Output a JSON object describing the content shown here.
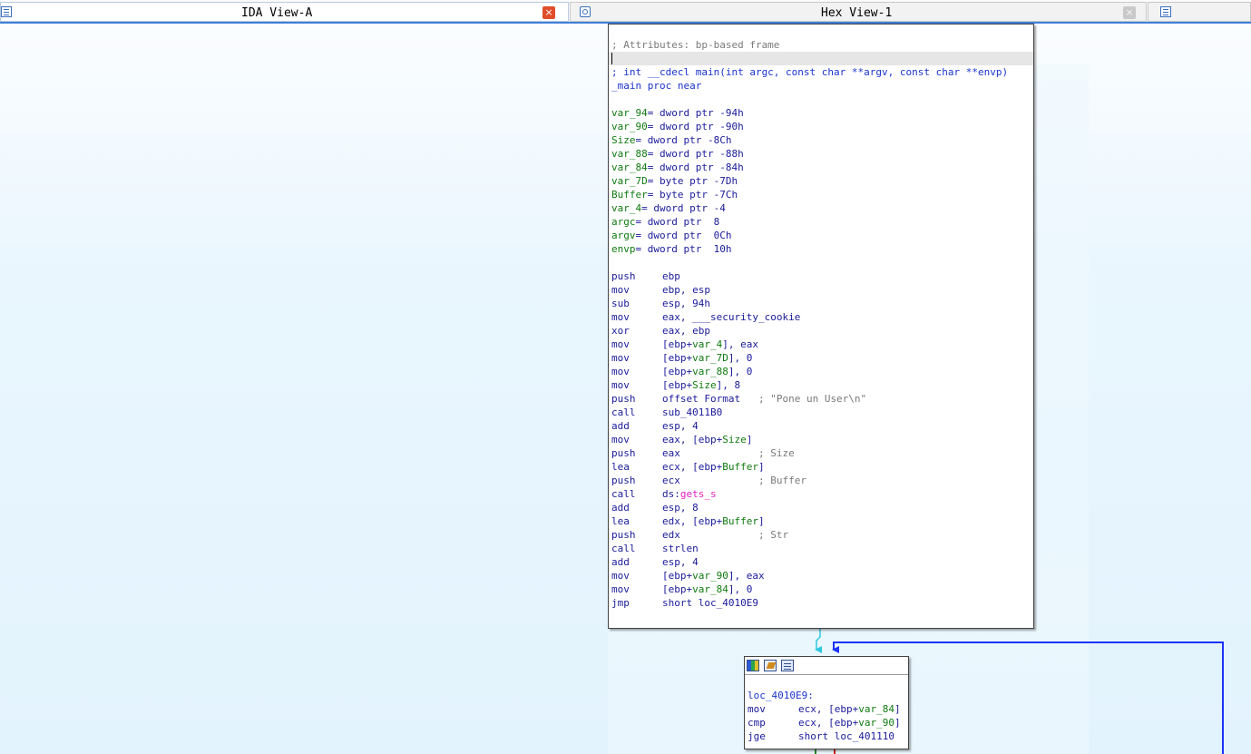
{
  "tabs": [
    {
      "title": "IDA View-A",
      "icon": "listing-icon",
      "close": "×"
    },
    {
      "title": "Hex View-1",
      "icon": "hex-view-icon",
      "close": "×"
    },
    {
      "icon": "structures-icon"
    }
  ],
  "colors": {
    "accent": "#3f7fd9",
    "close_active": "#e04e2c",
    "edge_blue": "#1a33ff",
    "edge_cyan": "#2ec8e0",
    "comment": "#7a7a7a",
    "mnemonic": "#1a1a9a",
    "var_name": "#0f7a0f",
    "import": "#e020c0"
  },
  "node_main": {
    "attr": "; Attributes: bp-based frame",
    "sig": "; int __cdecl main(int argc, const char **argv, const char **envp)",
    "proc": "_main proc near",
    "locals": [
      {
        "name": "var_94",
        "rest": "= dword ptr -94h"
      },
      {
        "name": "var_90",
        "rest": "= dword ptr -90h"
      },
      {
        "name": "Size",
        "rest": "= dword ptr -8Ch"
      },
      {
        "name": "var_88",
        "rest": "= dword ptr -88h"
      },
      {
        "name": "var_84",
        "rest": "= dword ptr -84h"
      },
      {
        "name": "var_7D",
        "rest": "= byte ptr -7Dh"
      },
      {
        "name": "Buffer",
        "rest": "= byte ptr -7Ch"
      },
      {
        "name": "var_4",
        "rest": "= dword ptr -4"
      },
      {
        "name": "argc",
        "rest": "= dword ptr  8"
      },
      {
        "name": "argv",
        "rest": "= dword ptr  0Ch"
      },
      {
        "name": "envp",
        "rest": "= dword ptr  10h"
      }
    ],
    "code": [
      {
        "m": "push",
        "a": "ebp",
        "c": ""
      },
      {
        "m": "mov",
        "a": "ebp, esp",
        "c": ""
      },
      {
        "m": "sub",
        "a": "esp, 94h",
        "c": ""
      },
      {
        "m": "mov",
        "a": "eax, ___security_cookie",
        "c": ""
      },
      {
        "m": "xor",
        "a": "eax, ebp",
        "c": ""
      },
      {
        "m": "mov",
        "a": "[ebp+var_4], eax",
        "c": ""
      },
      {
        "m": "mov",
        "a": "[ebp+var_7D], 0",
        "c": ""
      },
      {
        "m": "mov",
        "a": "[ebp+var_88], 0",
        "c": ""
      },
      {
        "m": "mov",
        "a": "[ebp+Size], 8",
        "c": ""
      },
      {
        "m": "push",
        "a": "offset Format   ",
        "c": "; \"Pone un User\\n\""
      },
      {
        "m": "call",
        "a": "sub_4011B0",
        "c": ""
      },
      {
        "m": "add",
        "a": "esp, 4",
        "c": ""
      },
      {
        "m": "mov",
        "a": "eax, [ebp+Size]",
        "c": ""
      },
      {
        "m": "push",
        "a": "eax             ",
        "c": "; Size"
      },
      {
        "m": "lea",
        "a": "ecx, [ebp+Buffer]",
        "c": ""
      },
      {
        "m": "push",
        "a": "ecx             ",
        "c": "; Buffer"
      },
      {
        "m": "call",
        "a": "ds:gets_s",
        "c": ""
      },
      {
        "m": "add",
        "a": "esp, 8",
        "c": ""
      },
      {
        "m": "lea",
        "a": "edx, [ebp+Buffer]",
        "c": ""
      },
      {
        "m": "push",
        "a": "edx             ",
        "c": "; Str"
      },
      {
        "m": "call",
        "a": "strlen",
        "c": ""
      },
      {
        "m": "add",
        "a": "esp, 4",
        "c": ""
      },
      {
        "m": "mov",
        "a": "[ebp+var_90], eax",
        "c": ""
      },
      {
        "m": "mov",
        "a": "[ebp+var_84], 0",
        "c": ""
      },
      {
        "m": "jmp",
        "a": "short loc_4010E9",
        "c": ""
      }
    ]
  },
  "node_loop": {
    "label": "loc_4010E9:",
    "toolbar": [
      "color-icon",
      "rename-icon",
      "list-icon"
    ],
    "code": [
      {
        "m": "mov",
        "a": "ecx, [ebp+var_84]"
      },
      {
        "m": "cmp",
        "a": "ecx, [ebp+var_90]"
      },
      {
        "m": "jge",
        "a": "short loc_401110"
      }
    ]
  }
}
